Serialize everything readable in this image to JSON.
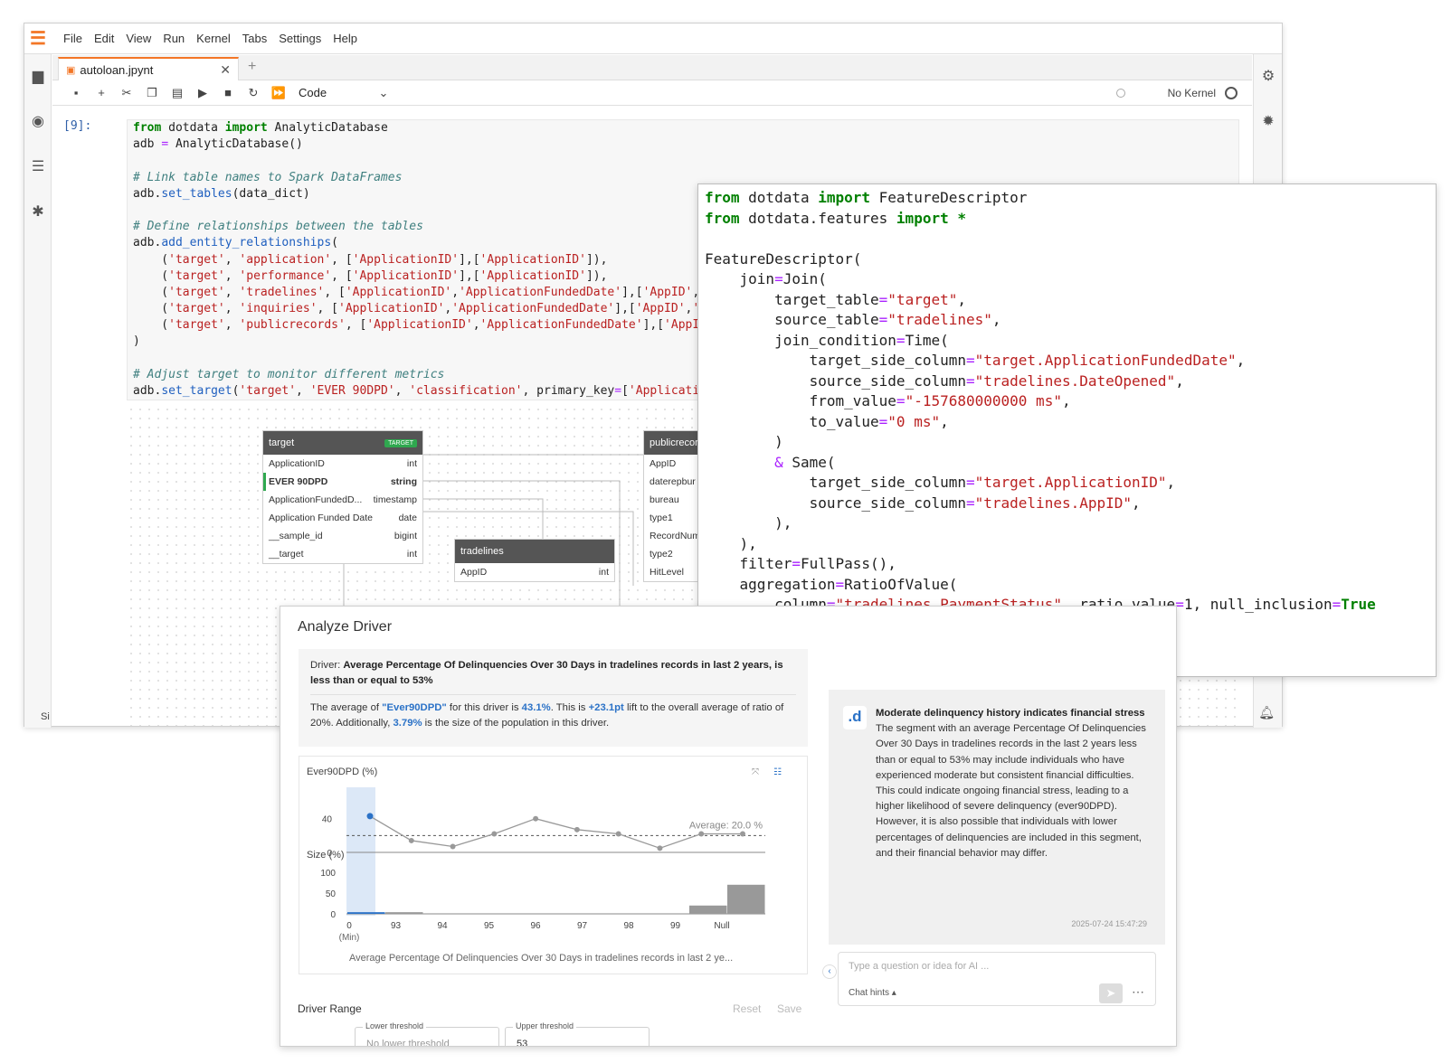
{
  "menu": [
    "File",
    "Edit",
    "View",
    "Run",
    "Kernel",
    "Tabs",
    "Settings",
    "Help"
  ],
  "tab": {
    "name": "autoloan.jpynt",
    "close": "✕",
    "add": "+"
  },
  "toolbar": {
    "cell_type": "Code",
    "kernel": "No Kernel"
  },
  "cell": {
    "prompt": "[9]:",
    "lines": [
      [
        {
          "t": "from",
          "c": "kw"
        },
        {
          "t": " dotdata "
        },
        {
          "t": "import",
          "c": "kw"
        },
        {
          "t": " AnalyticDatabase"
        }
      ],
      [
        {
          "t": "adb "
        },
        {
          "t": "=",
          "c": "eq"
        },
        {
          "t": " AnalyticDatabase()"
        }
      ],
      [],
      [
        {
          "t": "# Link table names to Spark DataFrames",
          "c": "cm"
        }
      ],
      [
        {
          "t": "adb."
        },
        {
          "t": "set_tables",
          "c": "fn"
        },
        {
          "t": "(data_dict)"
        }
      ],
      [],
      [
        {
          "t": "# Define relationships between the tables",
          "c": "cm"
        }
      ],
      [
        {
          "t": "adb."
        },
        {
          "t": "add_entity_relationships",
          "c": "fn"
        },
        {
          "t": "("
        }
      ],
      [
        {
          "t": "    ("
        },
        {
          "t": "'target'",
          "c": "st"
        },
        {
          "t": ", "
        },
        {
          "t": "'application'",
          "c": "st"
        },
        {
          "t": ", ["
        },
        {
          "t": "'ApplicationID'",
          "c": "st"
        },
        {
          "t": "],["
        },
        {
          "t": "'ApplicationID'",
          "c": "st"
        },
        {
          "t": "]),"
        }
      ],
      [
        {
          "t": "    ("
        },
        {
          "t": "'target'",
          "c": "st"
        },
        {
          "t": ", "
        },
        {
          "t": "'performance'",
          "c": "st"
        },
        {
          "t": ", ["
        },
        {
          "t": "'ApplicationID'",
          "c": "st"
        },
        {
          "t": "],["
        },
        {
          "t": "'ApplicationID'",
          "c": "st"
        },
        {
          "t": "]),"
        }
      ],
      [
        {
          "t": "    ("
        },
        {
          "t": "'target'",
          "c": "st"
        },
        {
          "t": ", "
        },
        {
          "t": "'tradelines'",
          "c": "st"
        },
        {
          "t": ", ["
        },
        {
          "t": "'ApplicationID'",
          "c": "st"
        },
        {
          "t": ","
        },
        {
          "t": "'ApplicationFundedDate'",
          "c": "st"
        },
        {
          "t": "],["
        },
        {
          "t": "'AppID'",
          "c": "st"
        },
        {
          "t": ","
        },
        {
          "t": "'D",
          "c": "st"
        }
      ],
      [
        {
          "t": "    ("
        },
        {
          "t": "'target'",
          "c": "st"
        },
        {
          "t": ", "
        },
        {
          "t": "'inquiries'",
          "c": "st"
        },
        {
          "t": ", ["
        },
        {
          "t": "'ApplicationID'",
          "c": "st"
        },
        {
          "t": ","
        },
        {
          "t": "'ApplicationFundedDate'",
          "c": "st"
        },
        {
          "t": "],["
        },
        {
          "t": "'AppID'",
          "c": "st"
        },
        {
          "t": ","
        },
        {
          "t": "'Ir",
          "c": "st"
        }
      ],
      [
        {
          "t": "    ("
        },
        {
          "t": "'target'",
          "c": "st"
        },
        {
          "t": ", "
        },
        {
          "t": "'publicrecords'",
          "c": "st"
        },
        {
          "t": ", ["
        },
        {
          "t": "'ApplicationID'",
          "c": "st"
        },
        {
          "t": ","
        },
        {
          "t": "'ApplicationFundedDate'",
          "c": "st"
        },
        {
          "t": "],["
        },
        {
          "t": "'AppID'",
          "c": "st"
        }
      ],
      [
        {
          "t": ")"
        }
      ],
      [],
      [
        {
          "t": "# Adjust target to monitor different metrics",
          "c": "cm"
        }
      ],
      [
        {
          "t": "adb."
        },
        {
          "t": "set_target",
          "c": "fn"
        },
        {
          "t": "("
        },
        {
          "t": "'target'",
          "c": "st"
        },
        {
          "t": ", "
        },
        {
          "t": "'EVER 90DPD'",
          "c": "st"
        },
        {
          "t": ", "
        },
        {
          "t": "'classification'",
          "c": "st"
        },
        {
          "t": ", primary_key"
        },
        {
          "t": "=",
          "c": "eq"
        },
        {
          "t": "["
        },
        {
          "t": "'Application",
          "c": "st"
        }
      ]
    ]
  },
  "erd": {
    "target": {
      "name": "target",
      "badge": "TARGET",
      "rows": [
        [
          "ApplicationID",
          "int"
        ],
        [
          "EVER 90DPD",
          "string"
        ],
        [
          "ApplicationFundedD...",
          "timestamp"
        ],
        [
          "Application Funded Date",
          "date"
        ],
        [
          "__sample_id",
          "bigint"
        ],
        [
          "__target",
          "int"
        ]
      ]
    },
    "tradelines": {
      "name": "tradelines",
      "rows": [
        [
          "AppID",
          "int"
        ]
      ]
    },
    "publicrecords": {
      "name": "publicrecords",
      "rows": [
        "AppID",
        "daterepbur",
        "bureau",
        "type1",
        "RecordNumber",
        "type2",
        "HitLevel"
      ]
    }
  },
  "feature_code": [
    [
      {
        "t": "from",
        "c": "kw"
      },
      {
        "t": " dotdata "
      },
      {
        "t": "import",
        "c": "kw"
      },
      {
        "t": " FeatureDescriptor"
      }
    ],
    [
      {
        "t": "from",
        "c": "kw"
      },
      {
        "t": " dotdata.features "
      },
      {
        "t": "import",
        "c": "kw"
      },
      {
        "t": " "
      },
      {
        "t": "*",
        "c": "kw"
      }
    ],
    [],
    [
      {
        "t": "FeatureDescriptor("
      }
    ],
    [
      {
        "t": "    join"
      },
      {
        "t": "=",
        "c": "eq"
      },
      {
        "t": "Join("
      }
    ],
    [
      {
        "t": "        target_table"
      },
      {
        "t": "=",
        "c": "eq"
      },
      {
        "t": "\"target\"",
        "c": "st"
      },
      {
        "t": ","
      }
    ],
    [
      {
        "t": "        source_table"
      },
      {
        "t": "=",
        "c": "eq"
      },
      {
        "t": "\"tradelines\"",
        "c": "st"
      },
      {
        "t": ","
      }
    ],
    [
      {
        "t": "        join_condition"
      },
      {
        "t": "=",
        "c": "eq"
      },
      {
        "t": "Time("
      }
    ],
    [
      {
        "t": "            target_side_column"
      },
      {
        "t": "=",
        "c": "eq"
      },
      {
        "t": "\"target.ApplicationFundedDate\"",
        "c": "st"
      },
      {
        "t": ","
      }
    ],
    [
      {
        "t": "            source_side_column"
      },
      {
        "t": "=",
        "c": "eq"
      },
      {
        "t": "\"tradelines.DateOpened\"",
        "c": "st"
      },
      {
        "t": ","
      }
    ],
    [
      {
        "t": "            from_value"
      },
      {
        "t": "=",
        "c": "eq"
      },
      {
        "t": "\"-157680000000 ms\"",
        "c": "st"
      },
      {
        "t": ","
      }
    ],
    [
      {
        "t": "            to_value"
      },
      {
        "t": "=",
        "c": "eq"
      },
      {
        "t": "\"0 ms\"",
        "c": "st"
      },
      {
        "t": ","
      }
    ],
    [
      {
        "t": "        )"
      }
    ],
    [
      {
        "t": "        "
      },
      {
        "t": "&",
        "c": "eq"
      },
      {
        "t": " Same("
      }
    ],
    [
      {
        "t": "            target_side_column"
      },
      {
        "t": "=",
        "c": "eq"
      },
      {
        "t": "\"target.ApplicationID\"",
        "c": "st"
      },
      {
        "t": ","
      }
    ],
    [
      {
        "t": "            source_side_column"
      },
      {
        "t": "=",
        "c": "eq"
      },
      {
        "t": "\"tradelines.AppID\"",
        "c": "st"
      },
      {
        "t": ","
      }
    ],
    [
      {
        "t": "        ),"
      }
    ],
    [
      {
        "t": "    ),"
      }
    ],
    [
      {
        "t": "    filter"
      },
      {
        "t": "=",
        "c": "eq"
      },
      {
        "t": "FullPass(),"
      }
    ],
    [
      {
        "t": "    aggregation"
      },
      {
        "t": "=",
        "c": "eq"
      },
      {
        "t": "RatioOfValue("
      }
    ],
    [
      {
        "t": "        column"
      },
      {
        "t": "=",
        "c": "eq"
      },
      {
        "t": "\"tradelines.PaymentStatus\"",
        "c": "st"
      },
      {
        "t": ", ratio_value"
      },
      {
        "t": "=",
        "c": "eq"
      },
      {
        "t": "1"
      },
      {
        "t": ", null_inclusion"
      },
      {
        "t": "=",
        "c": "eq"
      },
      {
        "t": "True",
        "c": "kw"
      }
    ],
    [
      {
        "t": "    ),"
      }
    ],
    [
      {
        "t": ")"
      }
    ]
  ],
  "analyze": {
    "title": "Analyze Driver",
    "driver_prefix": "Driver: ",
    "driver_text": "Average Percentage Of Delinquencies Over 30 Days in tradelines records in last 2 years, is less than or equal to 53%",
    "avg_1": "The average of ",
    "avg_target": "\"Ever90DPD\"",
    "avg_2": " for this driver is ",
    "avg_val": "43.1%",
    "avg_3": ". This is ",
    "avg_lift": "+23.1pt",
    "avg_4": " lift to the overall average of ratio of 20%. Additionally, ",
    "avg_size": "3.79%",
    "avg_5": " is the size of the population in this driver.",
    "range_label": "Driver Range",
    "reset": "Reset",
    "save": "Save",
    "lower_label": "Lower threshold",
    "lower_ph": "No lower threshold",
    "upper_label": "Upper threshold",
    "upper_val": "53"
  },
  "chart_data": {
    "type": "line",
    "title": "Ever90DPD (%)",
    "average_label": "Average: 20.0 %",
    "average": 20,
    "ylim_top": [
      0,
      50
    ],
    "yticks_top": [
      "40",
      "0"
    ],
    "x": [
      "0",
      "93",
      "94",
      "95",
      "96",
      "97",
      "98",
      "99",
      "Null"
    ],
    "x_sub": "(Min)",
    "line_values": [
      43,
      14,
      7,
      22,
      40,
      27,
      22,
      5,
      22,
      22
    ],
    "size_label": "Size (%)",
    "yticks_bottom": [
      "100",
      "50",
      "0"
    ],
    "ylim_bottom": [
      0,
      100
    ],
    "size_values": [
      4,
      4,
      0,
      0,
      0,
      0,
      0,
      0,
      0,
      20,
      70
    ],
    "xlabel": "Average Percentage Of Delinquencies Over 30 Days in tradelines records in last 2 ye..."
  },
  "ai": {
    "logo": ".d",
    "heading": "Moderate delinquency history indicates financial stress",
    "body": "The segment with an average Percentage Of Delinquencies Over 30 Days in tradelines records in the last 2 years less than or equal to 53% may include individuals who have experienced moderate but consistent financial difficulties. This could indicate ongoing financial stress, leading to a higher likelihood of severe delinquency (ever90DPD). However, it is also possible that individuals with lower percentages of delinquencies are included in this segment, and their financial behavior may differ.",
    "timestamp": "2025-07-24 15:47:29",
    "placeholder": "Type a question or idea for AI ...",
    "hints": "Chat hints ▴"
  },
  "status_left": "Si",
  "colors": {
    "accent": "#f37626",
    "keyword": "#008000",
    "string": "#ba2121",
    "highlight": "#2b72c7"
  }
}
